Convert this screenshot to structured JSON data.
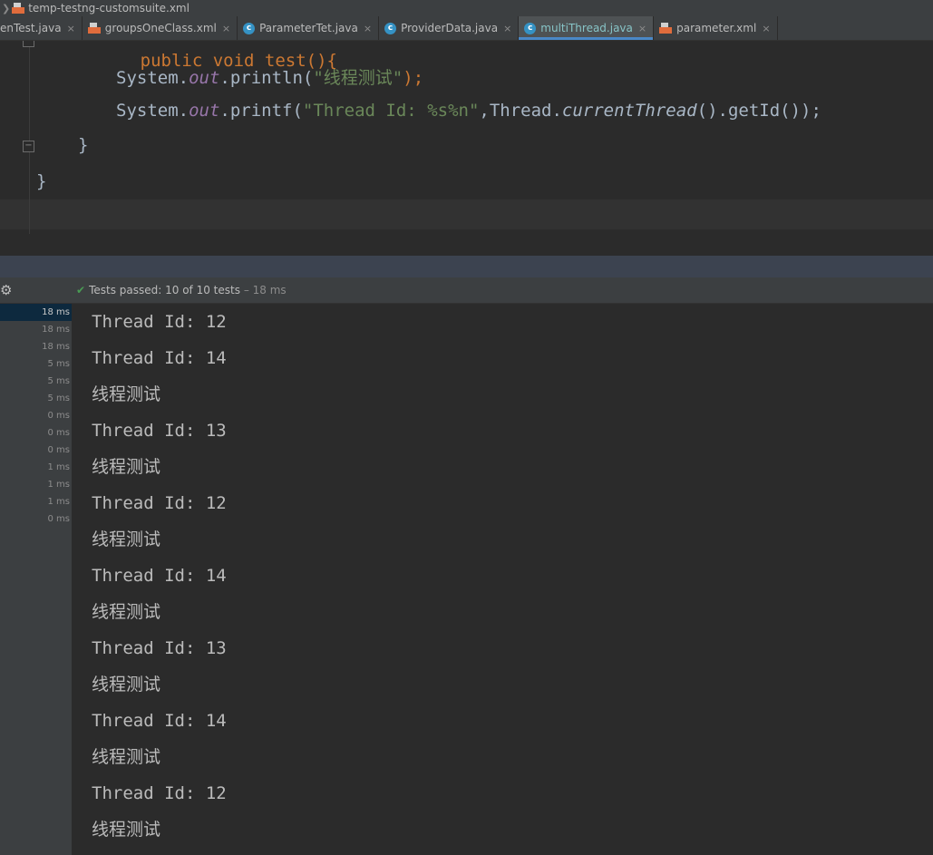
{
  "breadcrumb": {
    "file": "temp-testng-customsuite.xml"
  },
  "tabs": [
    {
      "label": "enTest.java",
      "icon": "none",
      "active": false
    },
    {
      "label": "groupsOneClass.xml",
      "icon": "xml-file-icon",
      "active": false
    },
    {
      "label": "ParameterTet.java",
      "icon": "java-class-icon",
      "active": false
    },
    {
      "label": "ProviderData.java",
      "icon": "java-class-icon",
      "active": false
    },
    {
      "label": "multiThread.java",
      "icon": "java-class-icon",
      "active": true
    },
    {
      "label": "parameter.xml",
      "icon": "xml-file-icon",
      "active": false
    }
  ],
  "editor": {
    "line_partial": "public void test(){",
    "line1": {
      "obj": "System.",
      "field": "out",
      "call": ".println(",
      "str": "\"线程测试\"",
      "end": ");"
    },
    "line2": {
      "obj": "System.",
      "field": "out",
      "call": ".printf(",
      "str": "\"Thread Id: %s%n\"",
      "mid": ",Thread.",
      "method": "currentThread",
      "end": "().getId());"
    },
    "close1": "}",
    "close2": "}"
  },
  "status": {
    "label": "Tests passed:",
    "passed": "10",
    "of": "of 10 tests",
    "time": "– 18 ms"
  },
  "durations": [
    "18 ms",
    "18 ms",
    "18 ms",
    "5 ms",
    "5 ms",
    "5 ms",
    "0 ms",
    "0 ms",
    "0 ms",
    "1 ms",
    "1 ms",
    "1 ms",
    "0 ms"
  ],
  "console": [
    "Thread Id: 12",
    "Thread Id: 14",
    "线程测试",
    "Thread Id: 13",
    "线程测试",
    "Thread Id: 12",
    "线程测试",
    "Thread Id: 14",
    "线程测试",
    "Thread Id: 13",
    "线程测试",
    "Thread Id: 14",
    "线程测试",
    "Thread Id: 12",
    "线程测试"
  ],
  "colors": {
    "accent": "#4a88c7",
    "pass": "#499c54",
    "background": "#2b2b2b"
  }
}
